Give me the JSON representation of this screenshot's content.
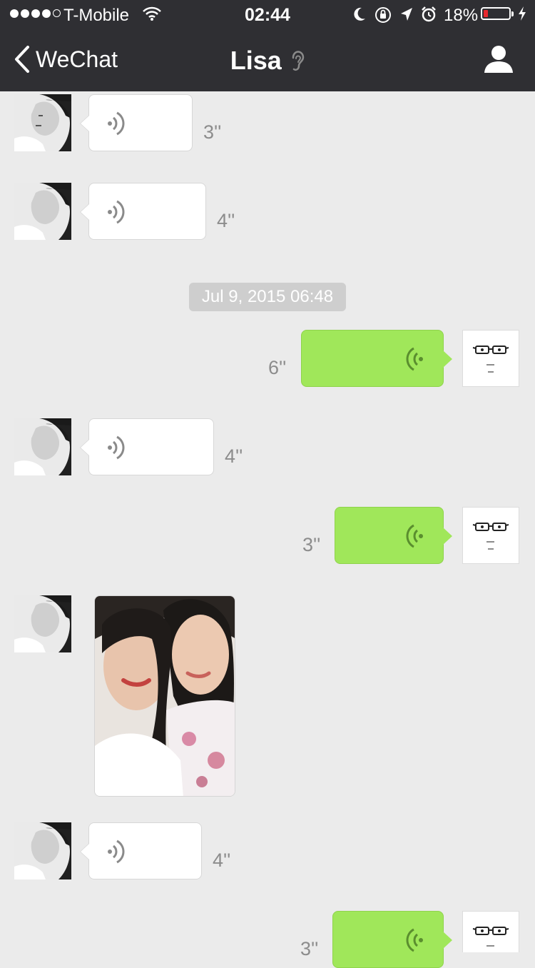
{
  "status_bar": {
    "carrier": "T-Mobile",
    "time": "02:44",
    "battery_percent": "18%",
    "battery_level": 0.18,
    "signal_bars": 4,
    "signal_max": 5
  },
  "nav": {
    "back_label": "WeChat",
    "title": "Lisa",
    "back_icon": "chevron-left-icon",
    "mode_icon": "ear-icon",
    "profile_icon": "person-icon"
  },
  "timestamp": "Jul 9, 2015 06:48",
  "messages": [
    {
      "from": "Lisa",
      "type": "voice",
      "duration": "3''"
    },
    {
      "from": "Lisa",
      "type": "voice",
      "duration": "4''"
    },
    {
      "from": "me",
      "type": "voice",
      "duration": "6''"
    },
    {
      "from": "Lisa",
      "type": "voice",
      "duration": "4''"
    },
    {
      "from": "me",
      "type": "voice",
      "duration": "3''"
    },
    {
      "from": "Lisa",
      "type": "image"
    },
    {
      "from": "Lisa",
      "type": "voice",
      "duration": "4''"
    },
    {
      "from": "me",
      "type": "voice",
      "duration": "3''"
    }
  ],
  "colors": {
    "header": "#2f2f33",
    "background": "#ebebeb",
    "outgoing_bubble": "#a0e75a",
    "incoming_bubble": "#ffffff",
    "battery_low": "#e8282d"
  }
}
